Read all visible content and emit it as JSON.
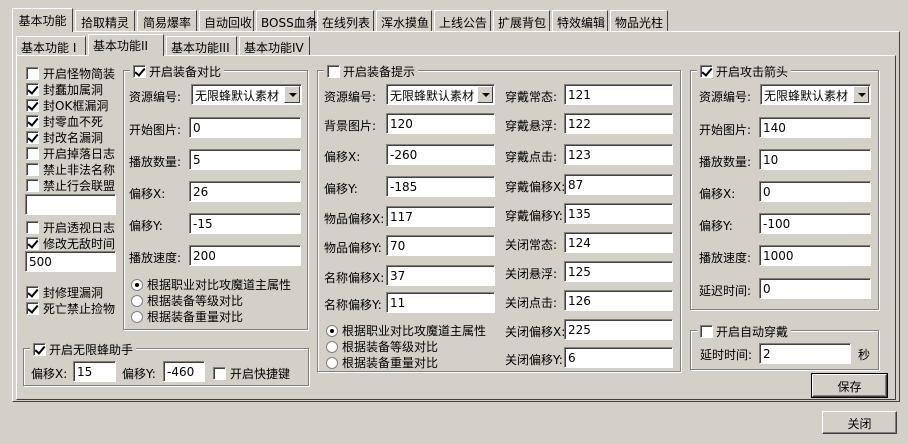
{
  "tabs_top": [
    "基本功能",
    "拾取精灵",
    "简易爆率",
    "自动回收",
    "BOSS血条",
    "在线列表",
    "浑水摸鱼",
    "上线公告",
    "扩展背包",
    "特效编辑",
    "物品光柱"
  ],
  "tabs_inner": [
    "基本功能 I",
    "基本功能II",
    "基本功能III",
    "基本功能IV"
  ],
  "left_checks": [
    {
      "label": "开启怪物简装",
      "checked": false
    },
    {
      "label": "封蠢加属洞",
      "checked": true
    },
    {
      "label": "封OK框漏洞",
      "checked": true
    },
    {
      "label": "封零血不死",
      "checked": true
    },
    {
      "label": "封改名漏洞",
      "checked": true
    },
    {
      "label": "开启掉落日志",
      "checked": false
    },
    {
      "label": "禁止非法名称",
      "checked": false
    },
    {
      "label": "禁止行会联盟",
      "checked": false
    }
  ],
  "left_blank_value": "",
  "left_checks2": [
    {
      "label": "开启透视日志",
      "checked": false
    },
    {
      "label": "修改无敌时间",
      "checked": true
    }
  ],
  "invincible_time": "500",
  "left_checks3": [
    {
      "label": "封修理漏洞",
      "checked": true
    },
    {
      "label": "死亡禁止捡物",
      "checked": true
    }
  ],
  "equip_compare": {
    "title": "开启装备对比",
    "checked": true,
    "resource_label": "资源编号:",
    "resource_value": "无限蜂默认素材",
    "fields": [
      {
        "label": "开始图片:",
        "value": "0"
      },
      {
        "label": "播放数量:",
        "value": "5"
      },
      {
        "label": "偏移X:",
        "value": "26"
      },
      {
        "label": "偏移Y:",
        "value": "-15"
      },
      {
        "label": "播放速度:",
        "value": "200"
      }
    ],
    "radios": [
      {
        "label": "根据职业对比攻魔道主属性",
        "checked": true
      },
      {
        "label": "根据装备等级对比",
        "checked": false
      },
      {
        "label": "根据装备重量对比",
        "checked": false
      }
    ]
  },
  "equip_tip": {
    "title": "开启装备提示",
    "checked": false,
    "resource_label": "资源编号:",
    "resource_value": "无限蜂默认素材",
    "left_fields": [
      {
        "label": "背景图片:",
        "value": "120"
      },
      {
        "label": "偏移X:",
        "value": "-260"
      },
      {
        "label": "偏移Y:",
        "value": "-185"
      },
      {
        "label": "物品偏移X:",
        "value": "117"
      },
      {
        "label": "物品偏移Y:",
        "value": "70"
      },
      {
        "label": "名称偏移X:",
        "value": "37"
      },
      {
        "label": "名称偏移Y:",
        "value": "11"
      }
    ],
    "right_fields": [
      {
        "label": "穿戴常态:",
        "value": "121"
      },
      {
        "label": "穿戴悬浮:",
        "value": "122"
      },
      {
        "label": "穿戴点击:",
        "value": "123"
      },
      {
        "label": "穿戴偏移X:",
        "value": "87"
      },
      {
        "label": "穿戴偏移Y:",
        "value": "135"
      },
      {
        "label": "关闭常态:",
        "value": "124"
      },
      {
        "label": "关闭悬浮:",
        "value": "125"
      },
      {
        "label": "关闭点击:",
        "value": "126"
      },
      {
        "label": "关闭偏移X:",
        "value": "225"
      },
      {
        "label": "关闭偏移Y:",
        "value": "6"
      }
    ],
    "radios": [
      {
        "label": "根据职业对比攻魔道主属性",
        "checked": true
      },
      {
        "label": "根据装备等级对比",
        "checked": false
      },
      {
        "label": "根据装备重量对比",
        "checked": false
      }
    ]
  },
  "attack_arrow": {
    "title": "开启攻击箭头",
    "checked": true,
    "resource_label": "资源编号:",
    "resource_value": "无限蜂默认素材",
    "fields": [
      {
        "label": "开始图片:",
        "value": "140"
      },
      {
        "label": "播放数量:",
        "value": "10"
      },
      {
        "label": "偏移X:",
        "value": "0"
      },
      {
        "label": "偏移Y:",
        "value": "-100"
      },
      {
        "label": "播放速度:",
        "value": "1000"
      },
      {
        "label": "延迟时间:",
        "value": "0"
      }
    ]
  },
  "auto_wear": {
    "title": "开启自动穿戴",
    "checked": false,
    "delay_label": "延时时间:",
    "delay_value": "2",
    "unit": "秒"
  },
  "helper": {
    "title": "开启无限蜂助手",
    "checked": true,
    "offset_x_label": "偏移X:",
    "offset_x_value": "15",
    "offset_y_label": "偏移Y:",
    "offset_y_value": "-460",
    "shortcut_label": "开启快捷键",
    "shortcut_checked": false
  },
  "buttons": {
    "save": "保存",
    "close": "关闭"
  }
}
